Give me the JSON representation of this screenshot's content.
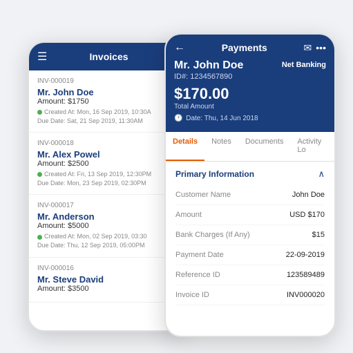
{
  "left_phone": {
    "header": {
      "title": "Invoices",
      "hamburger": "☰",
      "plus": "+"
    },
    "invoices": [
      {
        "id": "INV-000019",
        "name": "Mr. John Doe",
        "amount": "Amount: $1750",
        "created": "Created At: Mon, 16 Sep 2019, 10:30A",
        "due": "Due Date: Sat, 21 Sep 2019, 11:30AM"
      },
      {
        "id": "INV-000018",
        "name": "Mr. Alex Powel",
        "amount": "Amount: $2500",
        "created": "Created At: Fri, 13 Sep 2019, 12:30PM",
        "due": "Due Date: Mon, 23 Sep 2019, 02:30PM"
      },
      {
        "id": "INV-000017",
        "name": "Mr. Anderson",
        "amount": "Amount: $5000",
        "created": "Created At: Mon, 02 Sep 2019, 03:30",
        "due": "Due Date: Thu, 12 Sep 2019, 05:00PM"
      },
      {
        "id": "INV-000016",
        "name": "Mr. Steve David",
        "amount": "Amount: $3500",
        "created": "",
        "due": ""
      }
    ]
  },
  "right_phone": {
    "header": {
      "title": "Payments",
      "back": "←",
      "email_icon": "✉",
      "more_icon": "•••",
      "customer_name": "Mr. John Doe",
      "customer_id": "ID#: 1234567890",
      "amount": "$170.00",
      "total_label": "Total Amount",
      "payment_method": "Net Banking",
      "date": "Date: Thu, 14 Jun 2018"
    },
    "tabs": [
      {
        "label": "Details",
        "active": true
      },
      {
        "label": "Notes",
        "active": false
      },
      {
        "label": "Documents",
        "active": false
      },
      {
        "label": "Activity Lo",
        "active": false
      }
    ],
    "section_title": "Primary Information",
    "details": [
      {
        "label": "Customer Name",
        "value": "John Doe"
      },
      {
        "label": "Amount",
        "value": "USD $170"
      },
      {
        "label": "Bank Charges (If Any)",
        "value": "$15"
      },
      {
        "label": "Payment Date",
        "value": "22-09-2019"
      },
      {
        "label": "Reference ID",
        "value": "123589489"
      },
      {
        "label": "Invoice ID",
        "value": "INV000020"
      }
    ]
  }
}
